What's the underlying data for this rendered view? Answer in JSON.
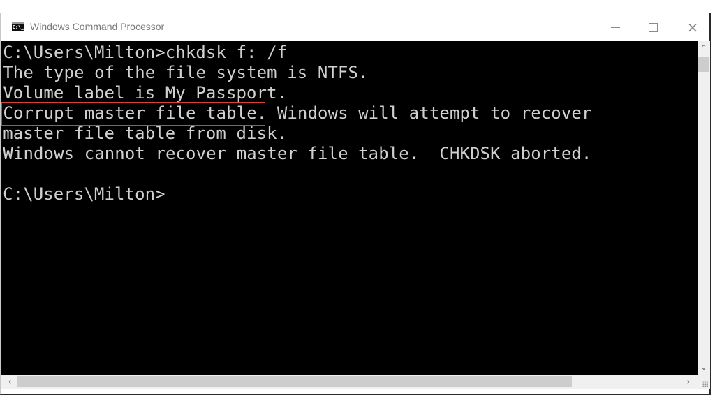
{
  "window": {
    "title": "Windows Command Processor",
    "icon": "cmd-icon",
    "icon_text": "C:\\_",
    "buttons": {
      "minimize": "minimize-icon",
      "maximize": "maximize-icon",
      "close": "×"
    }
  },
  "console": {
    "lines": [
      "C:\\Users\\Milton>chkdsk f: /f",
      "The type of the file system is NTFS.",
      "Volume label is My Passport.",
      "Corrupt master file table. Windows will attempt to recover",
      "master file table from disk.",
      "Windows cannot recover master file table.  CHKDSK aborted.",
      "",
      "C:\\Users\\Milton>"
    ],
    "highlighted_text": "Corrupt master file table.",
    "highlight_color": "#d9403a",
    "text_color": "#d0d0d0",
    "background_color": "#000000"
  },
  "scrollbars": {
    "up_arrow": "⌃",
    "down_arrow": "⌄",
    "left_arrow": "‹",
    "right_arrow": "›"
  }
}
